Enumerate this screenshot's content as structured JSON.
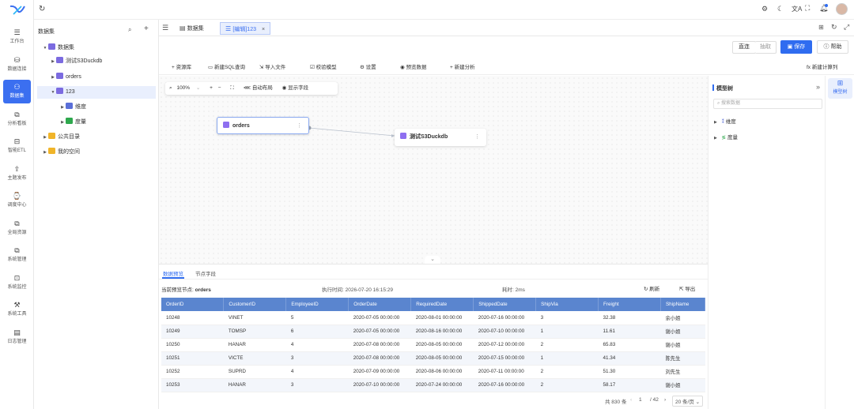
{
  "sidebar": {
    "items": [
      {
        "label": "工作台",
        "icon": "menu-icon"
      },
      {
        "label": "数据连接",
        "icon": "database-icon"
      },
      {
        "label": "数据集",
        "icon": "dataset-icon"
      },
      {
        "label": "分析看板",
        "icon": "dashboard-icon"
      },
      {
        "label": "智能ETL",
        "icon": "etl-icon"
      },
      {
        "label": "主题发布",
        "icon": "publish-icon"
      },
      {
        "label": "调度中心",
        "icon": "schedule-icon"
      },
      {
        "label": "全局资源",
        "icon": "resource-icon"
      },
      {
        "label": "系统管理",
        "icon": "system-icon"
      },
      {
        "label": "系统监控",
        "icon": "monitor-icon"
      },
      {
        "label": "系统工具",
        "icon": "tools-icon"
      },
      {
        "label": "日志管理",
        "icon": "log-icon"
      }
    ],
    "active_index": 2
  },
  "tree": {
    "title": "数据集",
    "items": [
      {
        "label": "数据集"
      },
      {
        "label": "测试S3Duckdb"
      },
      {
        "label": "orders"
      },
      {
        "label": "123"
      },
      {
        "label": "维度"
      },
      {
        "label": "度量"
      },
      {
        "label": "公共目录"
      },
      {
        "label": "我的空间"
      }
    ]
  },
  "tabs": [
    {
      "label": "数据集"
    },
    {
      "label": "[编辑]123"
    }
  ],
  "actions": {
    "direct": "直连",
    "extract": "抽取",
    "save": "保存",
    "help": "帮助"
  },
  "toolbar": {
    "items": [
      "资源库",
      "新建SQL查询",
      "导入文件",
      "校验模型",
      "设置",
      "预览数据",
      "新建分析"
    ],
    "calc_column": "新建计算列"
  },
  "canvas": {
    "zoom": "100%",
    "auto_layout": "自动布局",
    "show_fields": "显示字段",
    "nodes": [
      {
        "label": "orders"
      },
      {
        "label": "测试S3Duckdb"
      }
    ]
  },
  "right_panel": {
    "title": "模型树",
    "search_placeholder": "搜索数据",
    "items": [
      {
        "label": "维度"
      },
      {
        "label": "度量"
      }
    ],
    "rail_label": "模型树"
  },
  "bottom": {
    "tabs": [
      "数据预览",
      "节点字段"
    ],
    "node_label": "当前预览节点:",
    "node_value": "orders",
    "exec_time": "执行时间: 2026-07-20 16:15:29",
    "elapsed": "耗时: 2ms",
    "refresh": "刷新",
    "export": "导出",
    "columns": [
      "OrderID",
      "CustomerID",
      "EmployeeID",
      "OrderDate",
      "RequiredDate",
      "ShippedDate",
      "ShipVia",
      "Freight",
      "ShipName"
    ],
    "rows": [
      [
        "10248",
        "VINET",
        "5",
        "2020-07-05 00:00:00",
        "2020-08-01 00:00:00",
        "2020-07-16 00:00:00",
        "3",
        "32.38",
        "余小姐"
      ],
      [
        "10249",
        "TOMSP",
        "6",
        "2020-07-05 00:00:00",
        "2020-08-16 00:00:00",
        "2020-07-10 00:00:00",
        "1",
        "11.61",
        "谢小姐"
      ],
      [
        "10250",
        "HANAR",
        "4",
        "2020-07-08 00:00:00",
        "2020-08-05 00:00:00",
        "2020-07-12 00:00:00",
        "2",
        "65.83",
        "谢小姐"
      ],
      [
        "10251",
        "VICTE",
        "3",
        "2020-07-08 00:00:00",
        "2020-08-05 00:00:00",
        "2020-07-15 00:00:00",
        "1",
        "41.34",
        "陈先生"
      ],
      [
        "10252",
        "SUPRD",
        "4",
        "2020-07-09 00:00:00",
        "2020-08-06 00:00:00",
        "2020-07-11 00:00:00",
        "2",
        "51.30",
        "刘先生"
      ],
      [
        "10253",
        "HANAR",
        "3",
        "2020-07-10 00:00:00",
        "2020-07-24 00:00:00",
        "2020-07-16 00:00:00",
        "2",
        "58.17",
        "谢小姐"
      ]
    ],
    "total": "共 830 条",
    "page": "1",
    "pages": "/ 42",
    "page_size": "20 条/页"
  },
  "colors": {
    "accent": "#2f6cf0",
    "table_header": "#5a85cf"
  }
}
